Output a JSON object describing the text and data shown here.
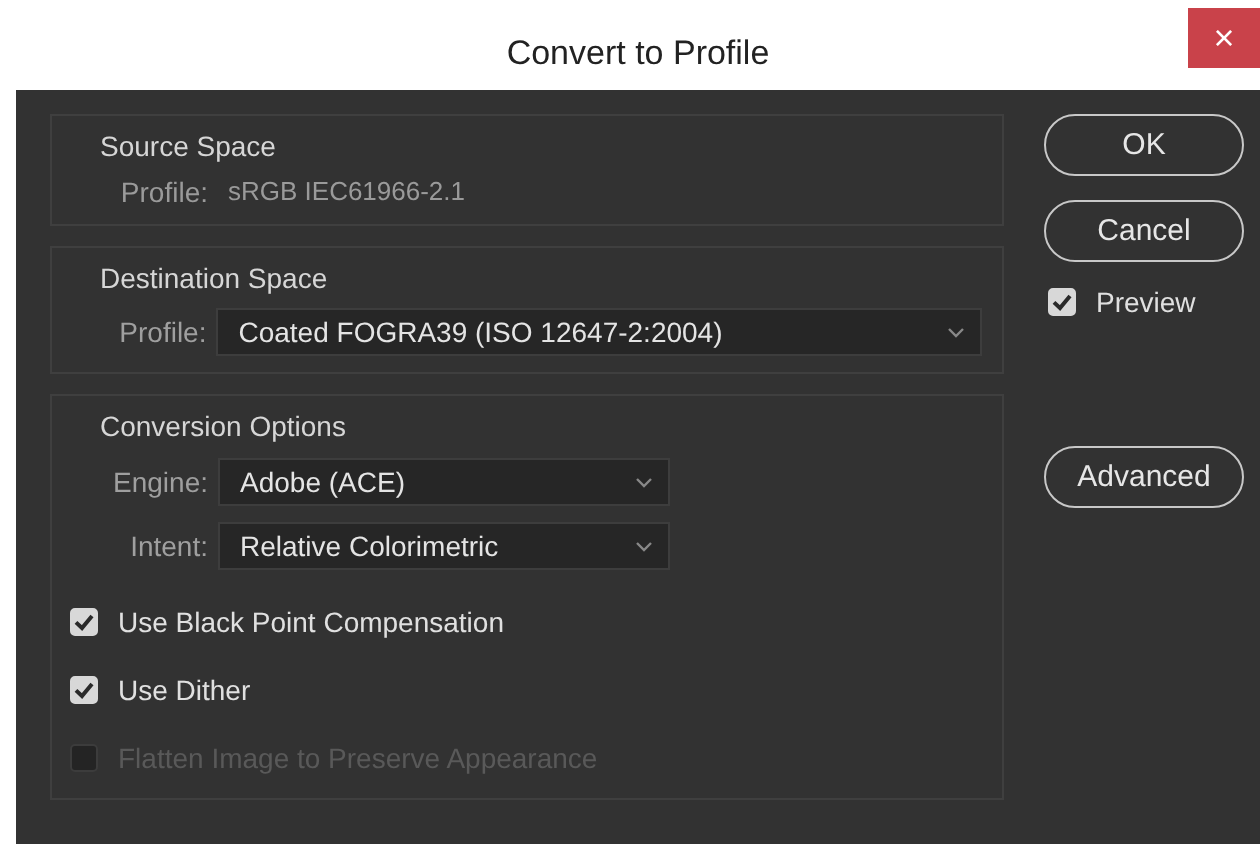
{
  "window": {
    "title": "Convert to Profile",
    "close": "×"
  },
  "source_space": {
    "title": "Source Space",
    "profile_label": "Profile:",
    "profile_value": "sRGB IEC61966-2.1"
  },
  "destination_space": {
    "title": "Destination Space",
    "profile_label": "Profile:",
    "profile_value": "Coated FOGRA39 (ISO 12647-2:2004)"
  },
  "conversion_options": {
    "title": "Conversion Options",
    "dropdowns": [
      {
        "label": "Engine:",
        "value": "Adobe (ACE)"
      },
      {
        "label": "Intent:",
        "value": "Relative Colorimetric"
      }
    ],
    "checkboxes": [
      {
        "label": "Use Black Point Compensation",
        "checked": true,
        "disabled": false
      },
      {
        "label": "Use Dither",
        "checked": true,
        "disabled": false
      },
      {
        "label": "Flatten Image to Preserve Appearance",
        "checked": false,
        "disabled": true
      }
    ]
  },
  "side": [
    {
      "kind": "button",
      "label": "OK"
    },
    {
      "kind": "button",
      "label": "Cancel"
    },
    {
      "kind": "checkbox",
      "label": "Preview",
      "checked": true
    },
    {
      "kind": "spacer"
    },
    {
      "kind": "button",
      "label": "Advanced"
    }
  ]
}
